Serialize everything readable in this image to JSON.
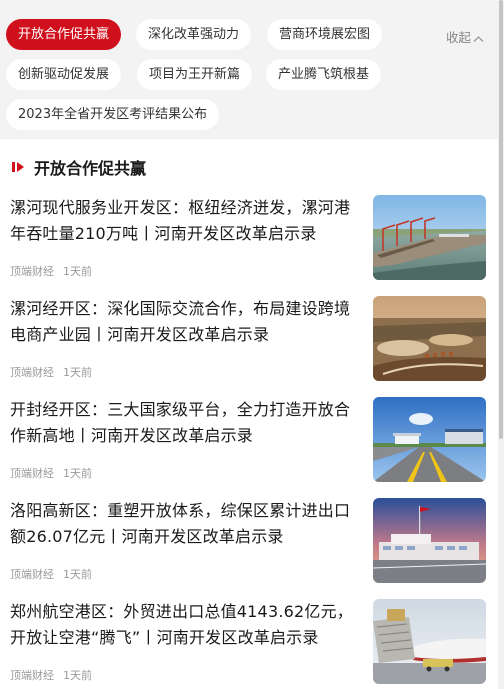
{
  "tags": [
    "开放合作促共赢",
    "深化改革强动力",
    "营商环境展宏图",
    "创新驱动促发展",
    "项目为王开新篇",
    "产业腾飞筑根基",
    "2023年全省开发区考评结果公布"
  ],
  "active_tag": "开放合作促共赢",
  "collapse_label": "收起",
  "section_title": "开放合作促共赢",
  "articles": [
    {
      "title": "漯河现代服务业开发区：枢纽经济迸发，漯河港年吞吐量210万吨丨河南开发区改革启示录",
      "source": "顶端财经",
      "time": "1天前",
      "image": "port-cranes-river"
    },
    {
      "title": "漯河经开区：深化国际交流合作，布局建设跨境电商产业园丨河南开发区改革启示录",
      "source": "顶端财经",
      "time": "1天前",
      "image": "aerial-industrial-park"
    },
    {
      "title": "开封经开区：三大国家级平台，全力打造开放合作新高地丨河南开发区改革启示录",
      "source": "顶端财经",
      "time": "1天前",
      "image": "road-gate-blue-sky"
    },
    {
      "title": "洛阳高新区：重塑开放体系，综保区累计进出口额26.07亿元丨河南开发区改革启示录",
      "source": "顶端财经",
      "time": "1天前",
      "image": "bonded-zone-building-flag"
    },
    {
      "title": "郑州航空港区：外贸进出口总值4143.62亿元，开放让空港“腾飞”丨河南开发区改革启示录",
      "source": "顶端财经",
      "time": "1天前",
      "image": "airport-cargo-loading"
    }
  ],
  "colors": {
    "accent": "#d0101c",
    "tag_bar_bg": "#f3f3f3",
    "meta_text": "#999999"
  }
}
